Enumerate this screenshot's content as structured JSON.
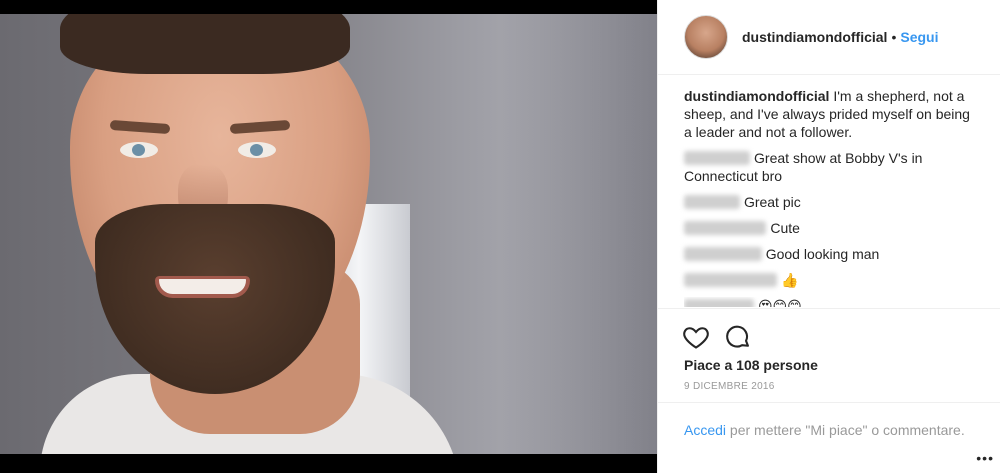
{
  "header": {
    "username": "dustindiamondofficial",
    "separator": "•",
    "follow_label": "Segui"
  },
  "caption": {
    "username": "dustindiamondofficial",
    "text": "I'm a shepherd, not a sheep, and I've always prided myself on being a leader and not a follower."
  },
  "comments": [
    {
      "username": "pieceofsky",
      "text": "Great show at Bobby V's in Connecticut bro"
    },
    {
      "username": "jdudgeifit",
      "text": "Great pic"
    },
    {
      "username": "carlachristian",
      "text": "Cute"
    },
    {
      "username": "brogllivdovie",
      "text": "Good looking man"
    },
    {
      "username": "andromediamo",
      "text": "👍"
    },
    {
      "username": "rebeccafort",
      "text": "😍😊😊"
    }
  ],
  "actions": {
    "like_icon": "heart-icon",
    "comment_icon": "comment-bubble-icon"
  },
  "likes_text": "Piace a 108 persone",
  "date_text": "9 DICEMBRE 2016",
  "login_prompt": {
    "link_label": "Accedi",
    "rest_text": " per mettere \"Mi piace\" o commentare."
  },
  "more_options_label": "•••",
  "colors": {
    "link_blue": "#3897f0",
    "text_dark": "#262626",
    "text_muted": "#999999",
    "divider": "#efefef"
  }
}
